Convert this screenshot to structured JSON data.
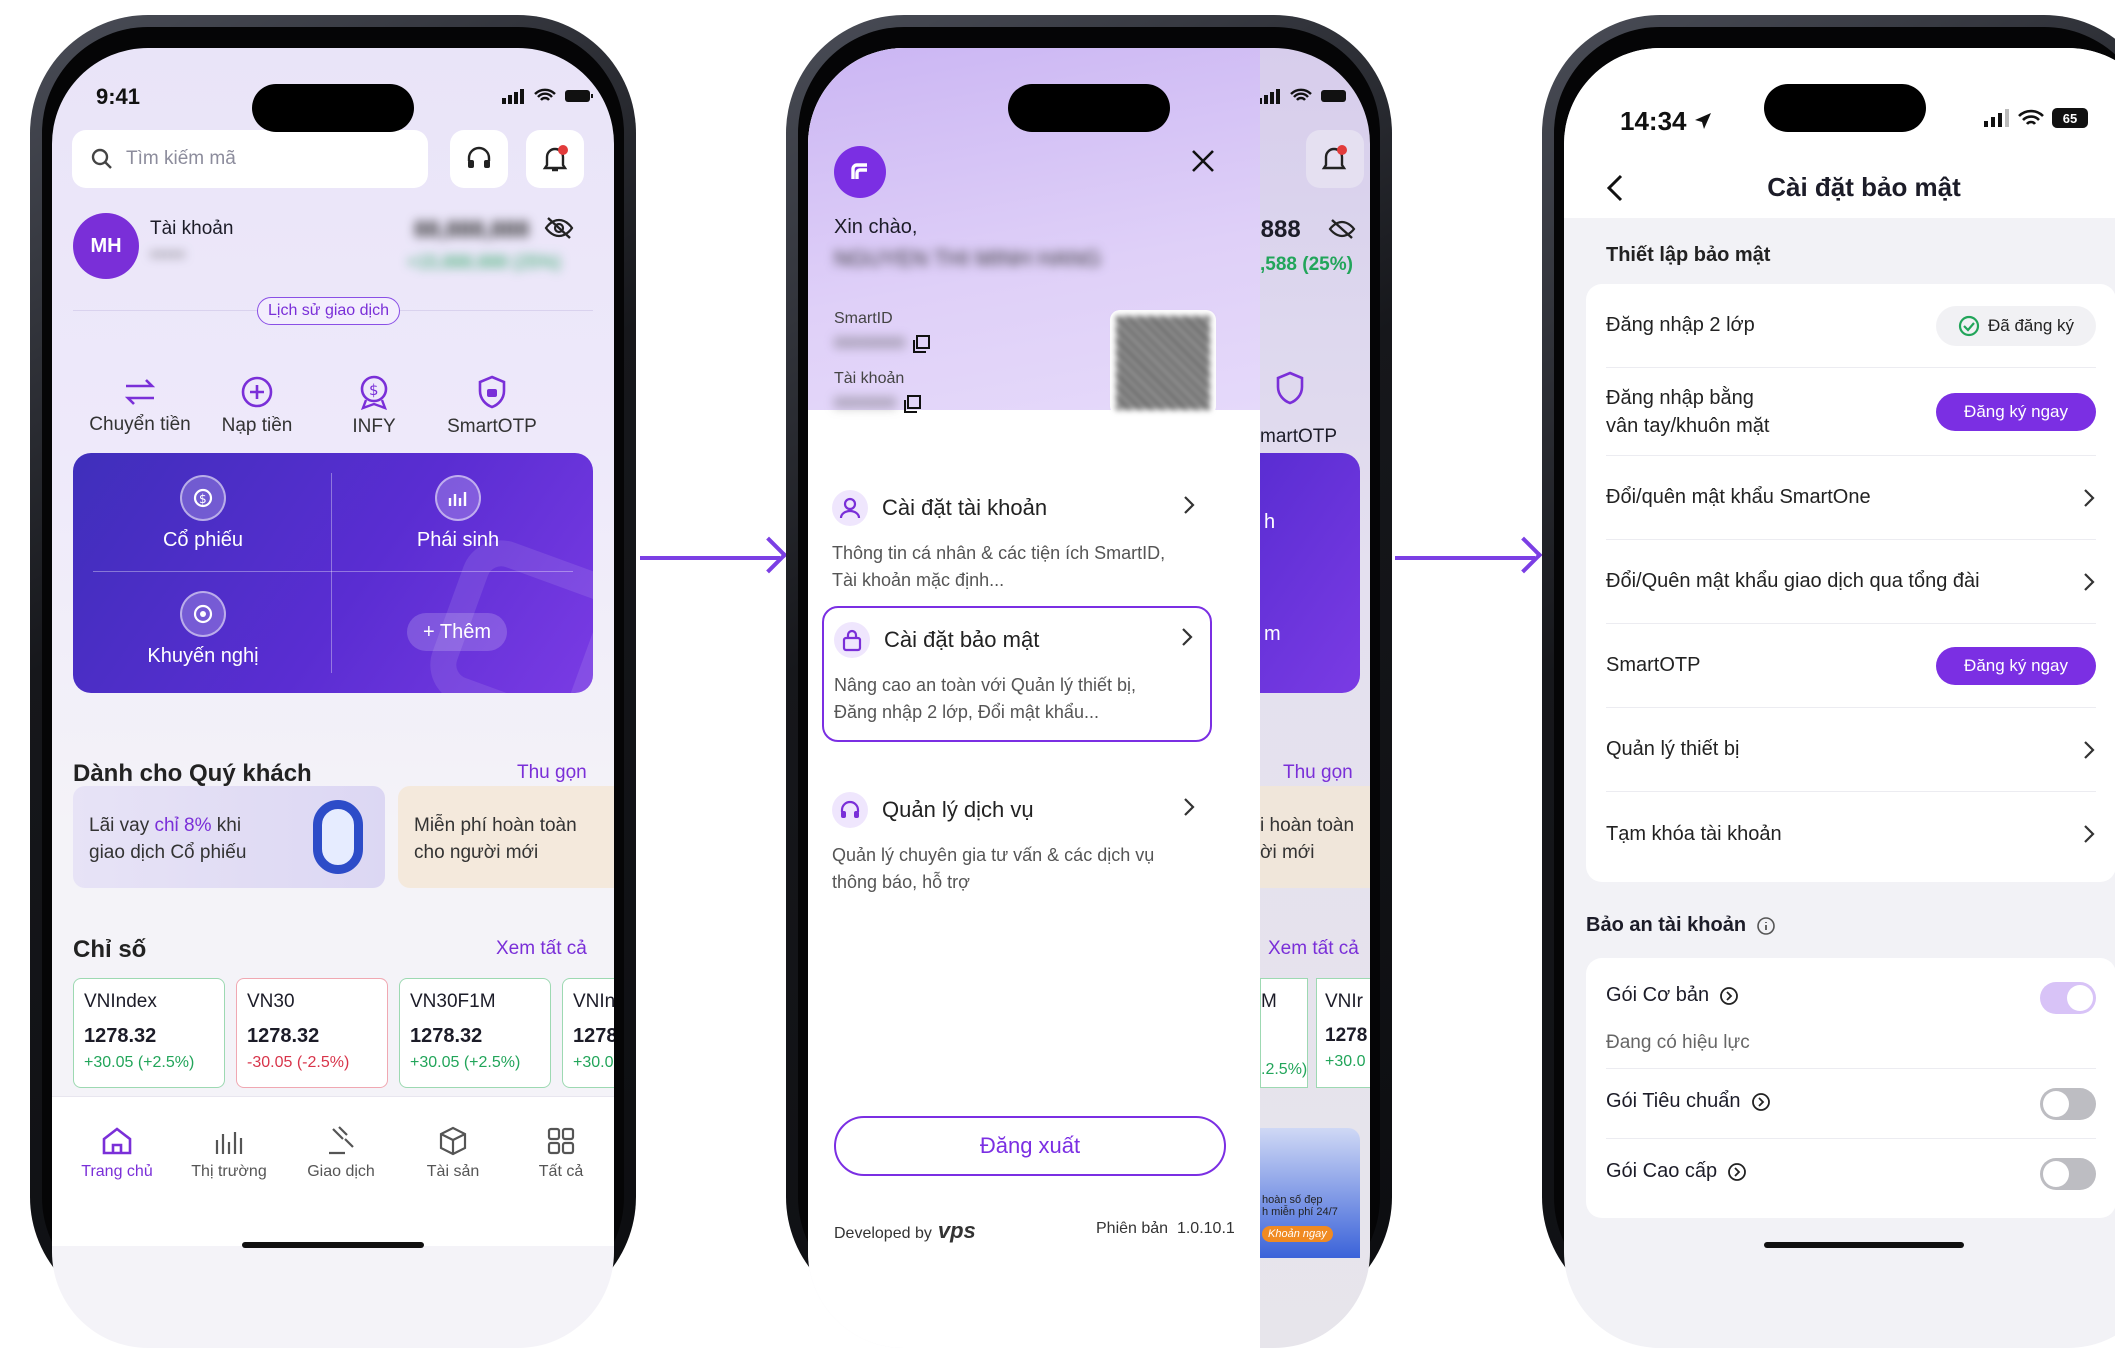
{
  "colors": {
    "accent": "#7b2fe3",
    "green": "#22a55a",
    "red": "#d8344a"
  },
  "arrows": [
    "arrow-right-icon",
    "arrow-right-icon"
  ],
  "p1": {
    "time": "9:41",
    "search_placeholder": "Tìm kiếm mã",
    "avatar": "MH",
    "account_label": "Tài khoản",
    "account_no": "*****",
    "balance": "88,888,888",
    "pl": "+15,888,888 (25%)",
    "history_btn": "Lịch sử giao dịch",
    "actions": [
      "Chuyển tiền",
      "Nạp tiền",
      "INFY",
      "SmartOTP"
    ],
    "card": {
      "stocks": "Cổ phiếu",
      "derivatives": "Phái sinh",
      "recommend": "Khuyến nghị",
      "more": "+ Thêm"
    },
    "for_you_title": "Dành cho Quý khách",
    "for_you_link": "Thu gọn",
    "promo1_a": "Lãi vay ",
    "promo1_hl": "chỉ 8%",
    "promo1_b": " khi",
    "promo1_c": "giao dịch Cổ phiếu",
    "promo2_a": "Miễn phí hoàn toàn",
    "promo2_b": "cho người mới",
    "index_title": "Chỉ số",
    "index_link": "Xem tất cả",
    "indices": [
      {
        "name": "VNIndex",
        "value": "1278.32",
        "change": "+30.05 (+2.5%)"
      },
      {
        "name": "VN30",
        "value": "1278.32",
        "change": "-30.05 (-2.5%)"
      },
      {
        "name": "VN30F1M",
        "value": "1278.32",
        "change": "+30.05 (+2.5%)"
      },
      {
        "name": "VNIn",
        "value": "1278",
        "change": "+30.0"
      }
    ],
    "tabs": [
      "Trang chủ",
      "Thị trường",
      "Giao dịch",
      "Tài sản",
      "Tất cả"
    ]
  },
  "p2": {
    "greeting": "Xin chào,",
    "name": "NGUYEN THI MINH HANG",
    "smartid_label": "SmartID",
    "smartid_value": "00000000",
    "account_label": "Tài khoản",
    "account_value": "0000000",
    "menu": [
      {
        "title": "Cài đặt tài khoản",
        "desc1": "Thông tin cá nhân & các tiện ích SmartID,",
        "desc2": "Tài khoản mặc định..."
      },
      {
        "title": "Cài đặt bảo mật",
        "desc1": "Nâng cao an toàn với Quản lý thiết bị,",
        "desc2": "Đăng nhập 2 lớp, Đổi mật khẩu..."
      },
      {
        "title": "Quản lý dịch vụ",
        "desc1": "Quản lý chuyên gia tư vấn & các dịch vụ",
        "desc2": "thông báo, hỗ trợ"
      }
    ],
    "logout": "Đăng xuất",
    "dev_by": "Developed by",
    "brand": "vps",
    "version": "Phiên bản  1.0.10.1",
    "bg_balance": ",888",
    "bg_pl": ",588 (25%)",
    "bg_otp": "martOTP",
    "bg_link": "Thu gọn",
    "bg_promo_a": "i hoàn toàn",
    "bg_promo_b": "ời mới",
    "bg_index_link": "Xem tất cả",
    "bg_m": "M",
    "bg_vn": "VNIr",
    "bg_chg": ".2.5%)",
    "bg_v": "1278",
    "bg_c": "+30.0",
    "bg_h": "h",
    "bg_mm": "m",
    "bg_banner_a": "hoàn số đẹp",
    "bg_banner_b": "h miễn phí 24/7",
    "bg_banner_btn": "Khoản ngay"
  },
  "p3": {
    "time": "14:34",
    "battery": "65",
    "title": "Cài đặt bảo mật",
    "sec1": "Thiết lập bảo mật",
    "r_2fa": "Đăng nhập 2 lớp",
    "r_2fa_badge": "Đã đăng ký",
    "r_bio1": "Đăng nhập bằng",
    "r_bio2": "vân tay/khuôn mặt",
    "r_bio_btn": "Đăng ký ngay",
    "r_pw": "Đổi/quên mật khẩu SmartOne",
    "r_tpw": "Đổi/Quên mật khẩu giao dịch qua tổng đài",
    "r_otp": "SmartOTP",
    "r_otp_btn": "Đăng ký ngay",
    "r_dev": "Quản lý thiết bị",
    "r_lock": "Tạm khóa tài khoản",
    "sec2": "Bảo an tài khoản",
    "g_basic": "Gói Cơ bản",
    "g_basic_status": "Đang có hiệu lực",
    "g_std": "Gói Tiêu chuẩn",
    "g_adv": "Gói Cao cấp",
    "toggles": {
      "basic": true,
      "standard": false,
      "advanced": false
    }
  }
}
